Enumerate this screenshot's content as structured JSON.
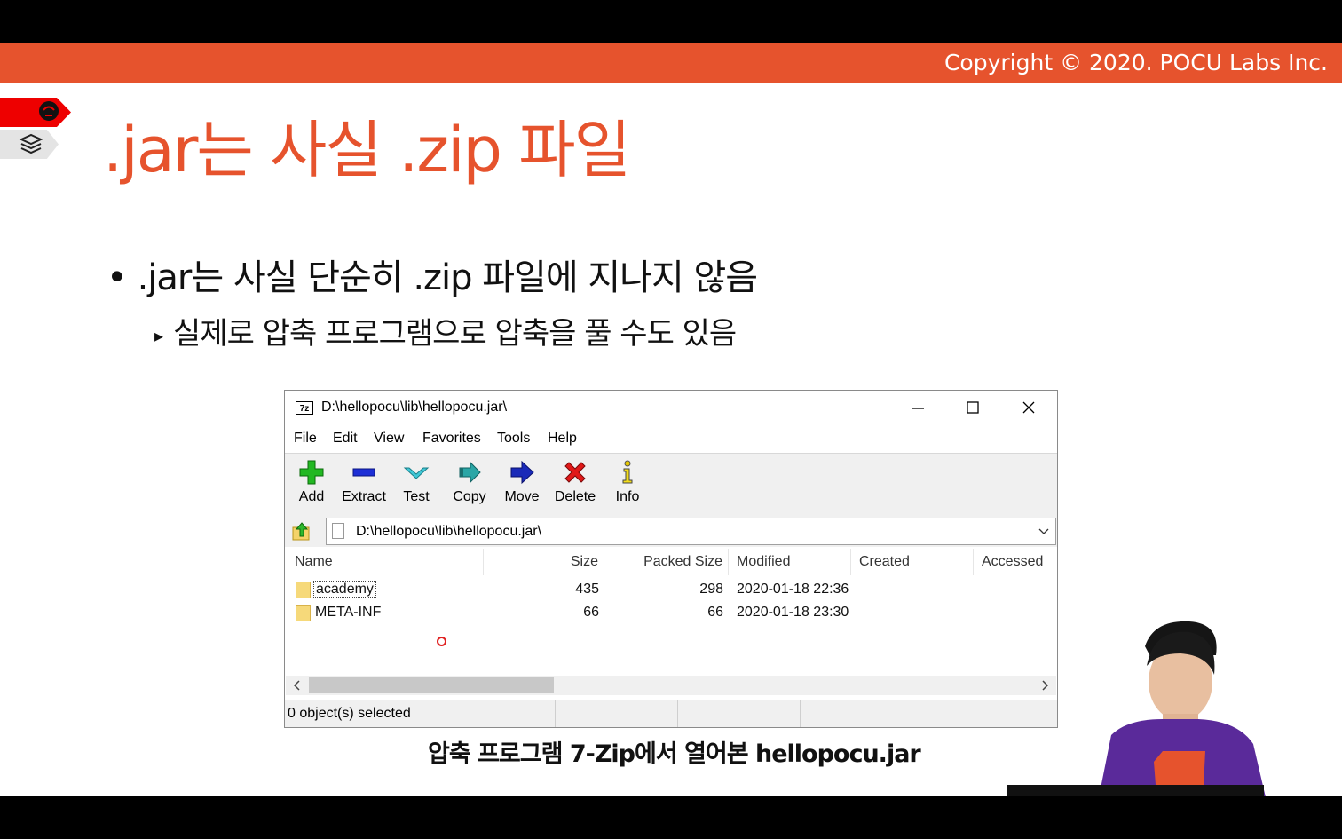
{
  "header": {
    "copyright": "Copyright © 2020. POCU Labs Inc."
  },
  "slide": {
    "title": ".jar는 사실 .zip 파일",
    "bullet1": ".jar는 사실 단순히 .zip 파일에 지나지 않음",
    "bullet2": "실제로 압축 프로그램으로 압축을 풀 수도 있음",
    "caption": "압축 프로그램 7-Zip에서 열어본 hellopocu.jar"
  },
  "window": {
    "app_icon": "7z",
    "title": "D:\\hellopocu\\lib\\hellopocu.jar\\",
    "menu": [
      "File",
      "Edit",
      "View",
      "Favorites",
      "Tools",
      "Help"
    ],
    "toolbar": [
      {
        "label": "Add",
        "icon": "add-icon"
      },
      {
        "label": "Extract",
        "icon": "extract-icon"
      },
      {
        "label": "Test",
        "icon": "test-icon"
      },
      {
        "label": "Copy",
        "icon": "copy-icon"
      },
      {
        "label": "Move",
        "icon": "move-icon"
      },
      {
        "label": "Delete",
        "icon": "delete-icon"
      },
      {
        "label": "Info",
        "icon": "info-icon"
      }
    ],
    "address": "D:\\hellopocu\\lib\\hellopocu.jar\\",
    "columns": [
      "Name",
      "Size",
      "Packed Size",
      "Modified",
      "Created",
      "Accessed"
    ],
    "rows": [
      {
        "name": "academy",
        "size": "435",
        "packed": "298",
        "modified": "2020-01-18 22:36"
      },
      {
        "name": "META-INF",
        "size": "66",
        "packed": "66",
        "modified": "2020-01-18 23:30"
      }
    ],
    "status": "0 object(s) selected"
  },
  "colors": {
    "accent": "#e6532d",
    "tag_red": "#ee0000"
  }
}
